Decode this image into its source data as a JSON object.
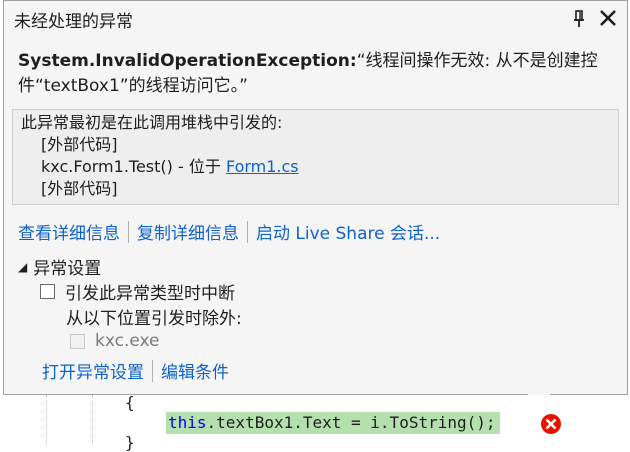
{
  "popup": {
    "title": "未经处理的异常",
    "exception_type": "System.InvalidOperationException:",
    "exception_message": "“线程间操作无效: 从不是创建控件“textBox1”的线程访问它。”",
    "stack_header": "此异常最初是在此调用堆栈中引发的:",
    "stack": {
      "line1": "[外部代码]",
      "line2_prefix": "kxc.Form1.Test() - 位于 ",
      "line2_link": "Form1.cs",
      "line3": "[外部代码]"
    },
    "actions": {
      "view_details": "查看详细信息",
      "copy_details": "复制详细信息",
      "live_share": "启动 Live Share 会话..."
    },
    "exception_settings": {
      "header": "异常设置",
      "break_when_thrown": "引发此异常类型时中断",
      "except_when_from": "从以下位置引发时除外:",
      "module": "kxc.exe",
      "open_settings": "打开异常设置",
      "edit_conditions": "编辑条件"
    }
  },
  "editor": {
    "open_brace": "{",
    "code_this": "this",
    "code_rest": ".textBox1.Text = i.ToString();",
    "close_brace": "}"
  }
}
